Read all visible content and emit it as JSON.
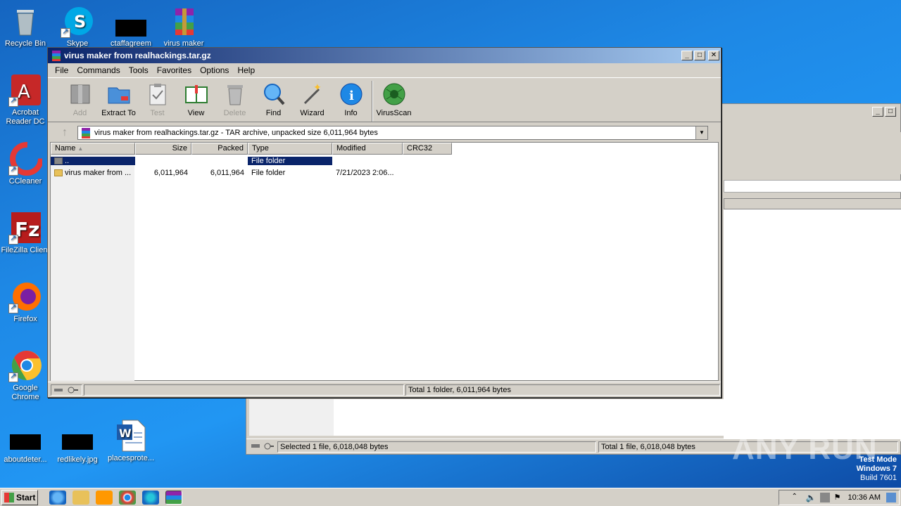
{
  "desktop": {
    "icons": [
      {
        "label": "Recycle Bin"
      },
      {
        "label": "Skype"
      },
      {
        "label": "ctaffagreem"
      },
      {
        "label": "virus maker"
      },
      {
        "label": "Acrobat Reader DC"
      },
      {
        "label": "CCleaner"
      },
      {
        "label": "FileZilla Client"
      },
      {
        "label": "Firefox"
      },
      {
        "label": "Google Chrome"
      },
      {
        "label": "aboutdeter..."
      },
      {
        "label": "redlikely.jpg"
      },
      {
        "label": "placesprote..."
      }
    ]
  },
  "window": {
    "title": "virus maker from realhackings.tar.gz",
    "controls": {
      "minimize": "_",
      "maximize": "□",
      "close": "✕"
    },
    "menu": [
      "File",
      "Commands",
      "Tools",
      "Favorites",
      "Options",
      "Help"
    ],
    "toolbar": [
      {
        "label": "Add",
        "icon": "add-archive-icon",
        "disabled": true
      },
      {
        "label": "Extract To",
        "icon": "extract-folder-icon",
        "disabled": false
      },
      {
        "label": "Test",
        "icon": "test-clipboard-icon",
        "disabled": true
      },
      {
        "label": "View",
        "icon": "view-book-icon",
        "disabled": false
      },
      {
        "label": "Delete",
        "icon": "trash-icon",
        "disabled": true
      },
      {
        "label": "Find",
        "icon": "magnifier-icon",
        "disabled": false
      },
      {
        "label": "Wizard",
        "icon": "wand-icon",
        "disabled": false
      },
      {
        "label": "Info",
        "icon": "info-icon",
        "disabled": false
      },
      {
        "label": "VirusScan",
        "icon": "virus-scan-icon",
        "disabled": false
      }
    ],
    "address": "virus maker from realhackings.tar.gz - TAR archive, unpacked size 6,011,964 bytes",
    "columns": [
      "Name",
      "Size",
      "Packed",
      "Type",
      "Modified",
      "CRC32"
    ],
    "rows": [
      {
        "name": "..",
        "size": "",
        "packed": "",
        "type": "File folder",
        "modified": "",
        "crc": "",
        "selected": true
      },
      {
        "name": "virus maker from ...",
        "size": "6,011,964",
        "packed": "6,011,964",
        "type": "File folder",
        "modified": "7/21/2023 2:06...",
        "crc": "",
        "selected": false
      }
    ],
    "status_total": "Total 1 folder, 6,011,964 bytes"
  },
  "bg_window": {
    "status_selected": "Selected 1 file, 6,018,048 bytes",
    "status_total": "Total 1 file, 6,018,048 bytes"
  },
  "taskbar": {
    "start_label": "Start",
    "clock": "10:36 AM"
  },
  "watermark": "ANY RUN",
  "testmode": {
    "line1": "Test Mode",
    "line2": "Windows 7",
    "line3": "Build 7601"
  }
}
